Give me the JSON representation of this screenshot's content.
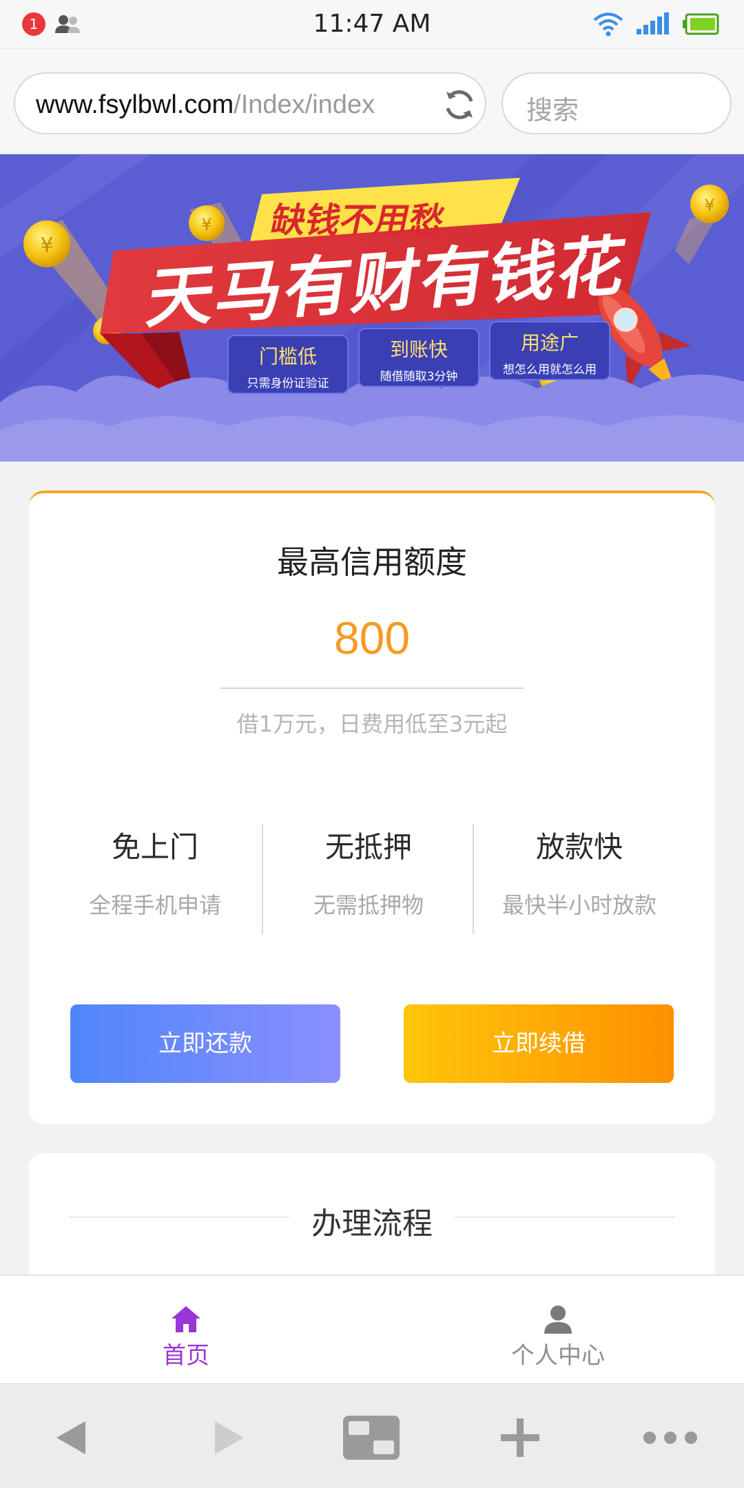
{
  "status_bar": {
    "notification_count": "1",
    "time": "11:47 AM"
  },
  "browser": {
    "url_domain": "www.fsylbwl.com",
    "url_path": "/Index/index",
    "search_placeholder": "搜索"
  },
  "banner": {
    "tagline": "缺钱不用愁",
    "title": "天马有财有钱花",
    "features": [
      {
        "title": "门槛低",
        "subtitle": "只需身份证验证"
      },
      {
        "title": "到账快",
        "subtitle": "随借随取3分钟"
      },
      {
        "title": "用途广",
        "subtitle": "想怎么用就怎么用"
      }
    ]
  },
  "credit": {
    "title": "最高信用额度",
    "amount": "800",
    "note": "借1万元，日费用低至3元起",
    "features": [
      {
        "title": "免上门",
        "subtitle": "全程手机申请"
      },
      {
        "title": "无抵押",
        "subtitle": "无需抵押物"
      },
      {
        "title": "放款快",
        "subtitle": "最快半小时放款"
      }
    ],
    "repay_label": "立即还款",
    "renew_label": "立即续借"
  },
  "process": {
    "title": "办理流程"
  },
  "tab_bar": {
    "home_label": "首页",
    "me_label": "个人中心"
  },
  "colors": {
    "accent_orange": "#f59a23",
    "tab_active": "#9a35d6",
    "repay_gradient": [
      "#4f86fb",
      "#8b8ffd"
    ],
    "renew_gradient": [
      "#fec60a",
      "#fe9000"
    ],
    "banner_bg": "#5d5fd4"
  },
  "icons": {
    "notification": "notification-badge",
    "contacts": "people-icon",
    "wifi": "wifi-icon",
    "signal": "signal-icon",
    "battery": "battery-icon",
    "reload": "reload-icon",
    "home": "home-icon",
    "profile": "user-icon",
    "back": "back-arrow-icon",
    "forward": "forward-arrow-icon",
    "tabs": "tabs-icon",
    "new_tab": "plus-icon",
    "menu": "more-dots-icon"
  }
}
